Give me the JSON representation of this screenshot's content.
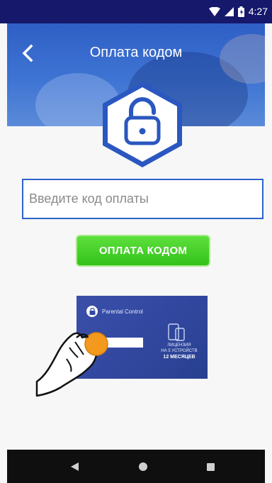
{
  "status_bar": {
    "time": "4:27",
    "icons": [
      "wifi-icon",
      "signal-icon",
      "battery-icon"
    ]
  },
  "header": {
    "title": "Оплата кодом",
    "back_icon": "chevron-left-icon"
  },
  "badge": {
    "icon": "lock-icon"
  },
  "form": {
    "code_placeholder": "Введите код оплаты",
    "code_value": "",
    "submit_label": "ОПЛАТА КОДОМ"
  },
  "card": {
    "brand": "Parental Control",
    "license_line1": "ЛИЦЕНЗИЯ",
    "license_line2": "НА 5 УСТРОЙСТВ",
    "months": "12 МЕСЯЦЕВ"
  },
  "nav": {
    "back_icon": "triangle-back-icon",
    "home_icon": "circle-home-icon",
    "recents_icon": "square-recents-icon"
  },
  "colors": {
    "status_bar": "#15186b",
    "header": "#3e74d3",
    "input_border": "#2d63c8",
    "button": "#33c21b",
    "coin": "#f39a1e",
    "card": "#3248a0",
    "navbar": "#0f0f0f"
  }
}
